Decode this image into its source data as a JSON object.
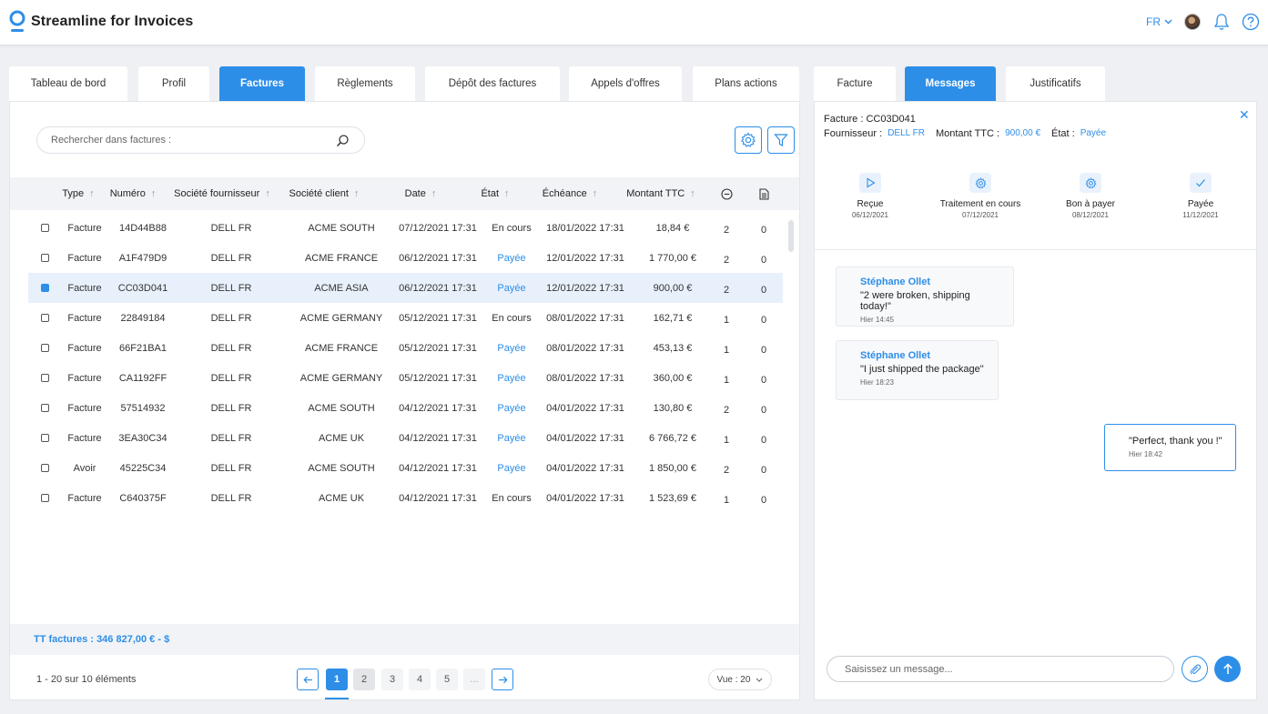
{
  "app": {
    "title": "Streamline for Invoices"
  },
  "header": {
    "language": "FR"
  },
  "tabs": [
    {
      "label": "Tableau de bord"
    },
    {
      "label": "Profil"
    },
    {
      "label": "Factures"
    },
    {
      "label": "Règlements"
    },
    {
      "label": "Dépôt des factures"
    },
    {
      "label": "Appels d'offres"
    },
    {
      "label": "Plans actions"
    }
  ],
  "detail_tabs": [
    {
      "label": "Facture"
    },
    {
      "label": "Messages"
    },
    {
      "label": "Justificatifs"
    }
  ],
  "search": {
    "placeholder": "Rechercher dans factures :"
  },
  "table": {
    "headers": [
      "Type",
      "Numéro",
      "Société fournisseur",
      "Société client",
      "Date",
      "État",
      "Échéance",
      "Montant TTC"
    ],
    "rows": [
      {
        "type": "Facture",
        "numero": "14D44B88",
        "fournisseur": "DELL FR",
        "client": "ACME SOUTH",
        "date": "07/12/2021 17:31",
        "etat": "En cours",
        "echeance": "18/01/2022 17:31",
        "montant": "18,84 €",
        "comments": "2",
        "docs": "0"
      },
      {
        "type": "Facture",
        "numero": "A1F479D9",
        "fournisseur": "DELL FR",
        "client": "ACME FRANCE",
        "date": "06/12/2021 17:31",
        "etat": "Payée",
        "echeance": "12/01/2022 17:31",
        "montant": "1 770,00 €",
        "comments": "2",
        "docs": "0"
      },
      {
        "type": "Facture",
        "numero": "CC03D041",
        "fournisseur": "DELL FR",
        "client": "ACME ASIA",
        "date": "06/12/2021 17:31",
        "etat": "Payée",
        "echeance": "12/01/2022 17:31",
        "montant": "900,00 €",
        "comments": "2",
        "docs": "0"
      },
      {
        "type": "Facture",
        "numero": "22849184",
        "fournisseur": "DELL FR",
        "client": "ACME GERMANY",
        "date": "05/12/2021 17:31",
        "etat": "En cours",
        "echeance": "08/01/2022 17:31",
        "montant": "162,71 €",
        "comments": "1",
        "docs": "0"
      },
      {
        "type": "Facture",
        "numero": "66F21BA1",
        "fournisseur": "DELL FR",
        "client": "ACME FRANCE",
        "date": "05/12/2021 17:31",
        "etat": "Payée",
        "echeance": "08/01/2022 17:31",
        "montant": "453,13 €",
        "comments": "1",
        "docs": "0"
      },
      {
        "type": "Facture",
        "numero": "CA1192FF",
        "fournisseur": "DELL FR",
        "client": "ACME GERMANY",
        "date": "05/12/2021 17:31",
        "etat": "Payée",
        "echeance": "08/01/2022 17:31",
        "montant": "360,00 €",
        "comments": "1",
        "docs": "0"
      },
      {
        "type": "Facture",
        "numero": "57514932",
        "fournisseur": "DELL FR",
        "client": "ACME SOUTH",
        "date": "04/12/2021 17:31",
        "etat": "Payée",
        "echeance": "04/01/2022 17:31",
        "montant": "130,80 €",
        "comments": "2",
        "docs": "0"
      },
      {
        "type": "Facture",
        "numero": "3EA30C34",
        "fournisseur": "DELL FR",
        "client": "ACME UK",
        "date": "04/12/2021 17:31",
        "etat": "Payée",
        "echeance": "04/01/2022 17:31",
        "montant": "6 766,72 €",
        "comments": "1",
        "docs": "0"
      },
      {
        "type": "Avoir",
        "numero": "45225C34",
        "fournisseur": "DELL FR",
        "client": "ACME SOUTH",
        "date": "04/12/2021 17:31",
        "etat": "Payée",
        "echeance": "04/01/2022 17:31",
        "montant": "1 850,00 €",
        "comments": "2",
        "docs": "0"
      },
      {
        "type": "Facture",
        "numero": "C640375F",
        "fournisseur": "DELL FR",
        "client": "ACME UK",
        "date": "04/12/2021 17:31",
        "etat": "En cours",
        "echeance": "04/01/2022 17:31",
        "montant": "1 523,69 €",
        "comments": "1",
        "docs": "0"
      }
    ]
  },
  "totals": {
    "label": "TT factures : 346 827,00 €   - $"
  },
  "pagination": {
    "info": "1 - 20 sur 10 éléments",
    "pages": [
      "1",
      "2",
      "3",
      "4",
      "5",
      "..."
    ],
    "current": "1",
    "view": "Vue : 20"
  },
  "invoice_detail": {
    "title": "Facture : CC03D041",
    "fournisseur_label": "Fournisseur :",
    "fournisseur_value": "DELL FR",
    "montant_label": "Montant TTC :",
    "montant_value": "900,00 €",
    "etat_label": "État :",
    "etat_value": "Payée",
    "steps": [
      {
        "label": "Reçue",
        "date": "06/12/2021"
      },
      {
        "label": "Traitement en cours",
        "date": "07/12/2021"
      },
      {
        "label": "Bon à payer",
        "date": "08/12/2021"
      },
      {
        "label": "Payée",
        "date": "11/12/2021"
      }
    ]
  },
  "messages": [
    {
      "author": "Stéphane Ollet",
      "text": "\"2 were broken, shipping today!\"",
      "time": "Hier 14:45",
      "own": false
    },
    {
      "author": "Stéphane Ollet",
      "text": "\"I just shipped the package\"",
      "time": "Hier 18:23",
      "own": false
    },
    {
      "author": "",
      "text": "\"Perfect, thank you !\"",
      "time": "Hier 18:42",
      "own": true
    }
  ],
  "composer": {
    "placeholder": "Saisissez un message..."
  },
  "colors": {
    "accent": "#2d8ee8",
    "selected_row": "#e8f0fb",
    "background": "#eef0f3"
  }
}
